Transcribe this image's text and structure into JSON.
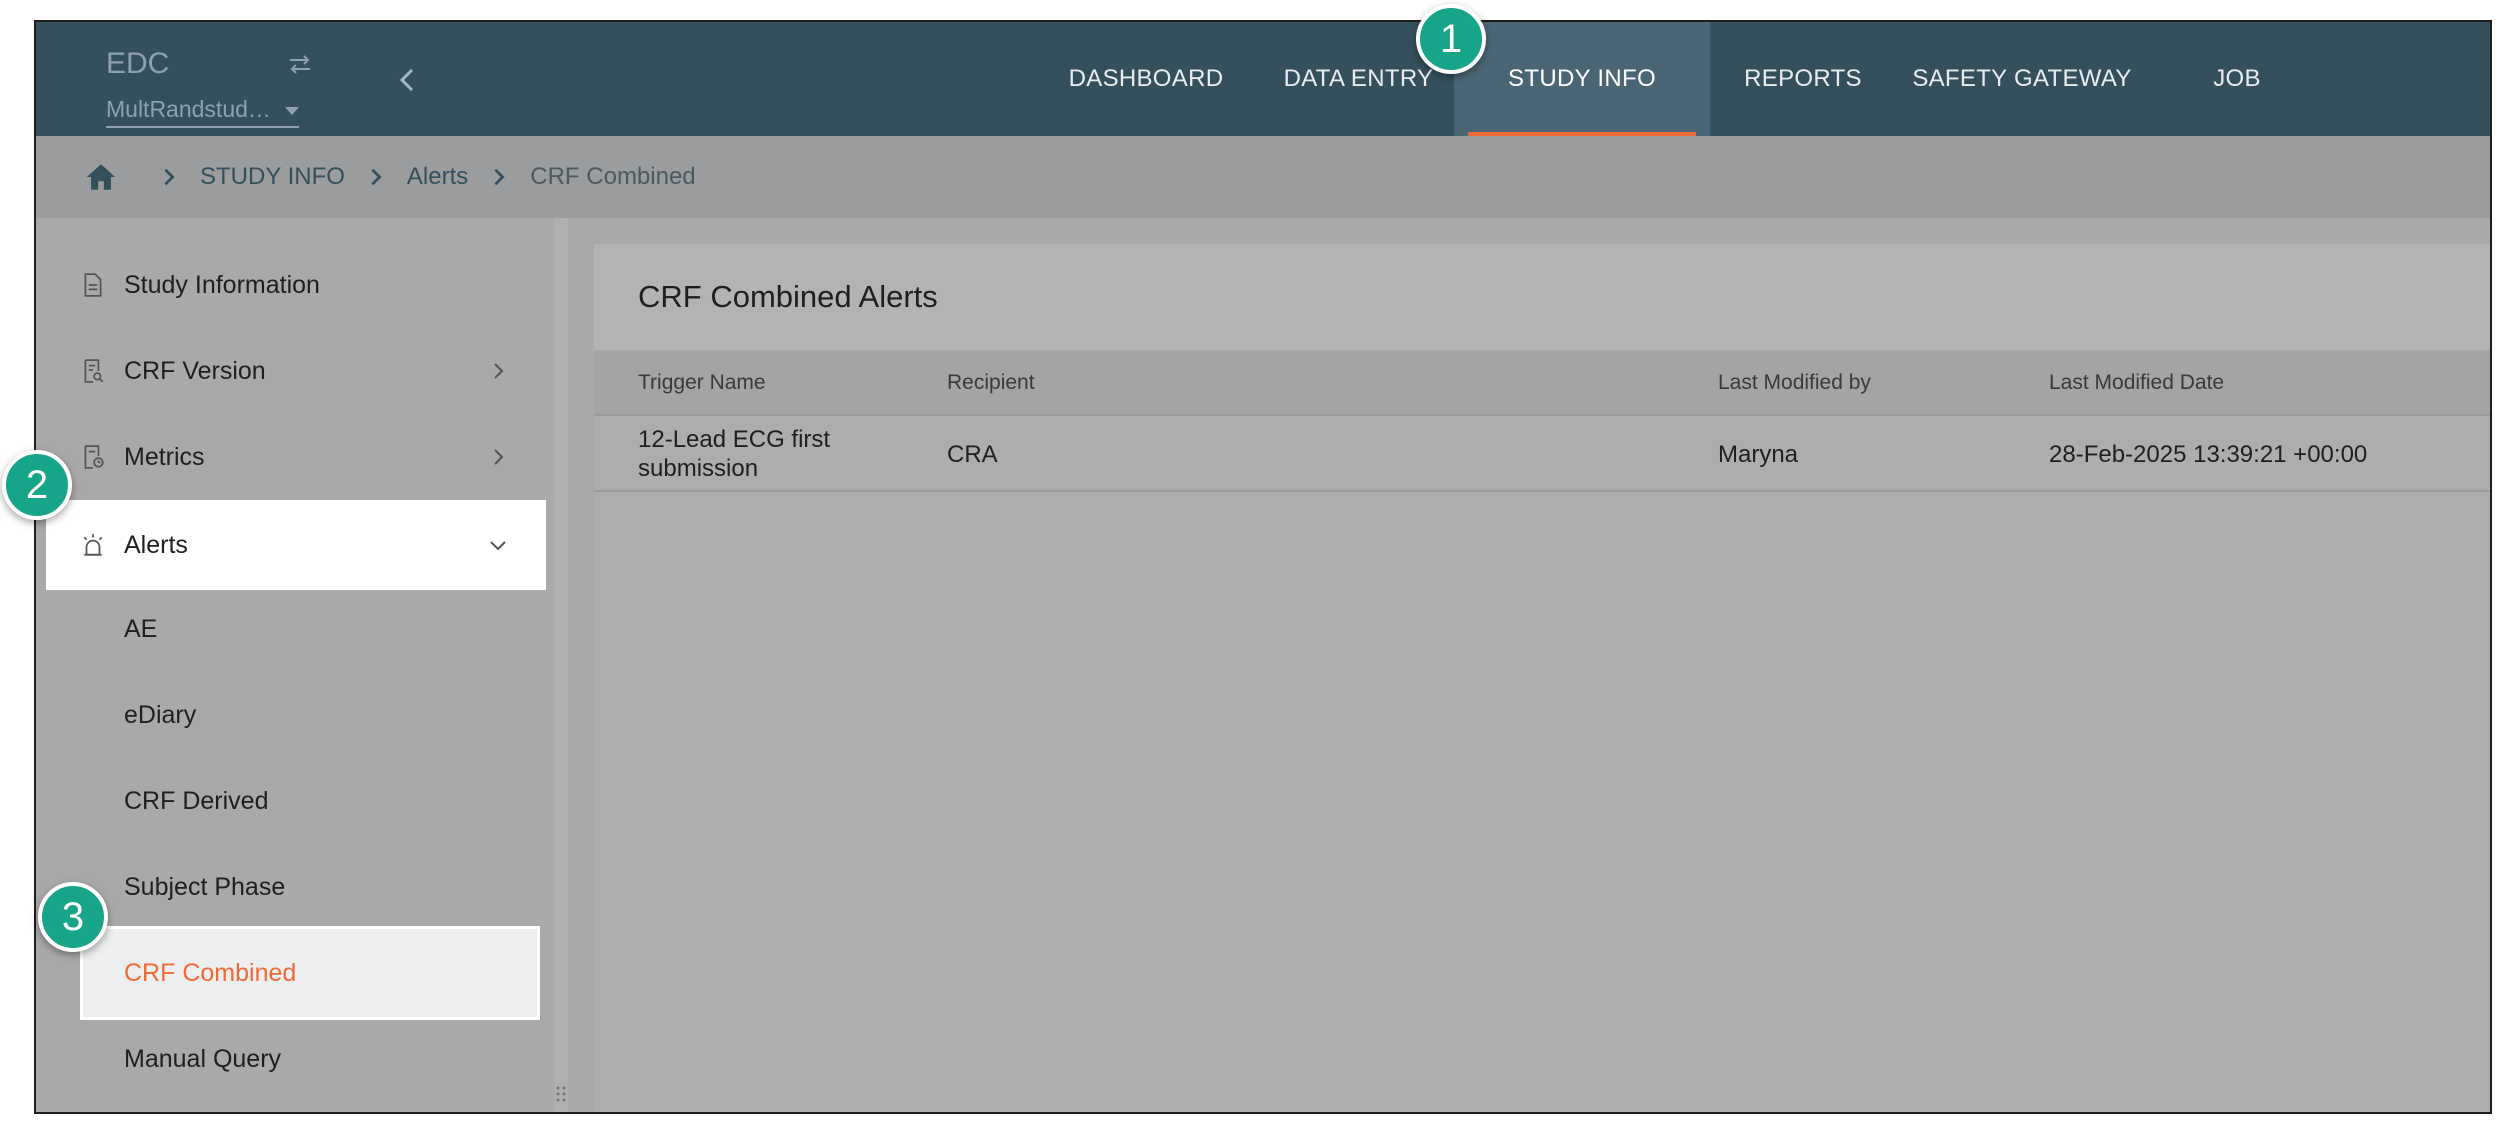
{
  "header": {
    "app_title": "EDC",
    "study_name": "MultRandstud…",
    "icons": {
      "swap": "swap-icon",
      "collapse": "chevron-left-icon",
      "dropdown": "caret-down-icon"
    }
  },
  "nav": {
    "items": [
      {
        "label": "DASHBOARD"
      },
      {
        "label": "DATA ENTRY"
      },
      {
        "label": "STUDY INFO",
        "active": true
      },
      {
        "label": "REPORTS"
      },
      {
        "label": "SAFETY GATEWAY"
      },
      {
        "label": "JOB"
      }
    ],
    "active_underline_color": "#f06a38"
  },
  "breadcrumb": {
    "items": [
      "STUDY INFO",
      "Alerts",
      "CRF Combined"
    ],
    "home_icon": "home-icon"
  },
  "sidebar": {
    "items": [
      {
        "label": "Study Information",
        "icon": "document-icon"
      },
      {
        "label": "CRF Version",
        "icon": "document-search-icon",
        "expandable": true
      },
      {
        "label": "Metrics",
        "icon": "document-clock-icon",
        "expandable": true
      },
      {
        "label": "Alerts",
        "icon": "alarm-icon",
        "expanded": true
      }
    ],
    "sub_items": [
      {
        "label": "AE"
      },
      {
        "label": "eDiary"
      },
      {
        "label": "CRF Derived"
      },
      {
        "label": "Subject Phase"
      },
      {
        "label": "CRF Combined",
        "selected": true
      },
      {
        "label": "Manual Query"
      }
    ],
    "selected_color": "#f06a38"
  },
  "panel": {
    "title": "CRF Combined Alerts",
    "columns": [
      "Trigger Name",
      "Recipient",
      "Last Modified by",
      "Last Modified Date"
    ],
    "rows": [
      [
        "12-Lead ECG first submission",
        "CRA",
        "Maryna",
        "28-Feb-2025 13:39:21 +00:00"
      ]
    ]
  },
  "callouts": [
    "1",
    "2",
    "3"
  ],
  "colors": {
    "topbar": "#35505d",
    "badge": "#17a58a"
  }
}
